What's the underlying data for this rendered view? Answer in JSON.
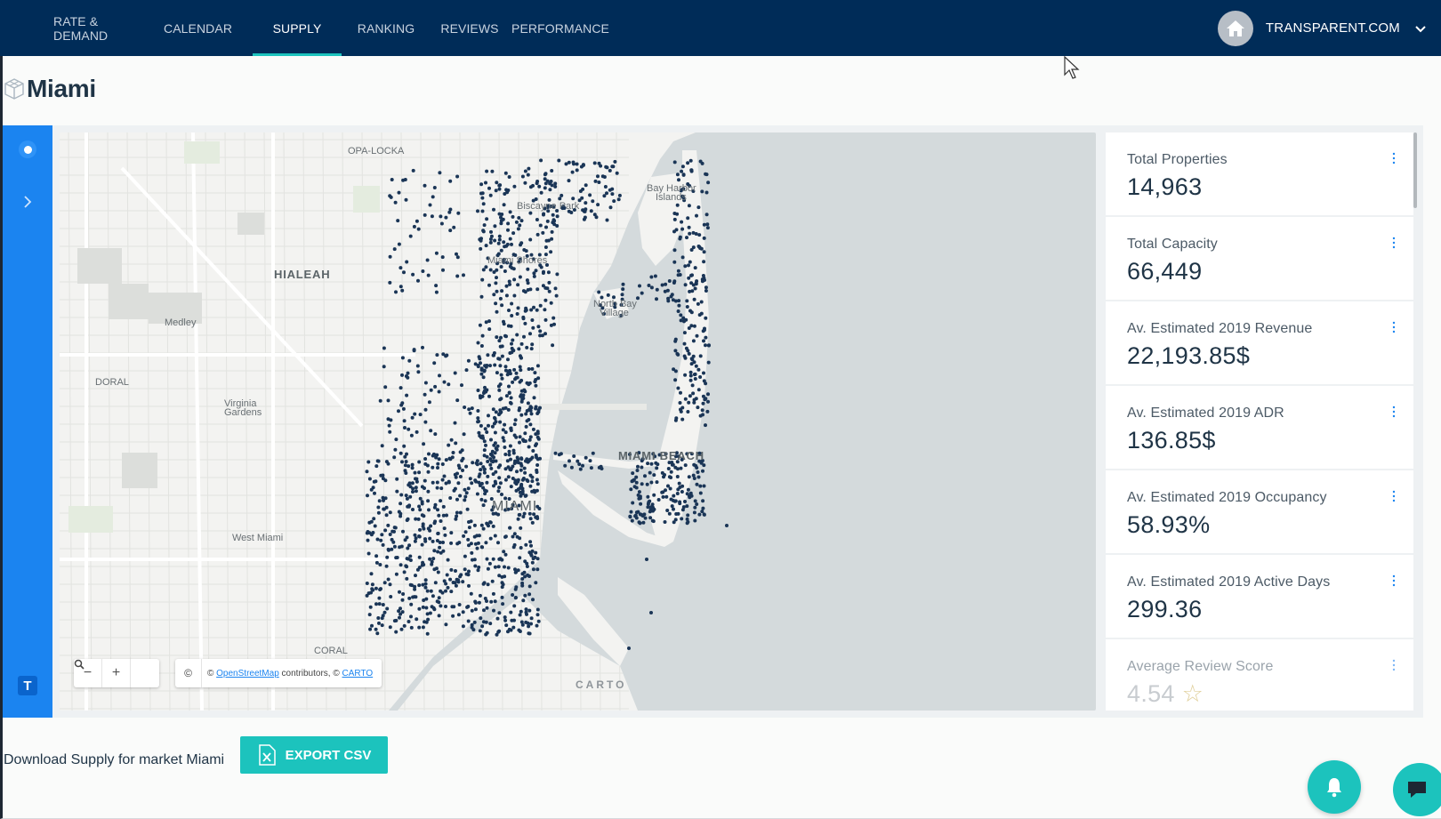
{
  "nav": {
    "tabs": [
      {
        "label": "RATE & DEMAND",
        "active": false
      },
      {
        "label": "CALENDAR",
        "active": false
      },
      {
        "label": "SUPPLY",
        "active": true
      },
      {
        "label": "RANKING",
        "active": false
      },
      {
        "label": "REVIEWS",
        "active": false
      },
      {
        "label": "PERFORMANCE",
        "active": false
      }
    ],
    "account": {
      "name": "TRANSPARENT.COM",
      "avatar_icon": "home-icon",
      "menu_icon": "chevron-down-icon"
    }
  },
  "page": {
    "title": "Miami",
    "title_icon": "cube-icon"
  },
  "map": {
    "labels": {
      "opa_locka": "OPA-LOCKA",
      "hialeah": "HIALEAH",
      "medley": "Medley",
      "doral": "DORAL",
      "virginia_gardens_1": "Virginia",
      "virginia_gardens_2": "Gardens",
      "west_miami": "West Miami",
      "biscayne_park": "Biscayne Park",
      "miami_shores": "Miami Shores",
      "north_bay_1": "North Bay",
      "north_bay_2": "Village",
      "bay_harbor_1": "Bay Harbor",
      "bay_harbor_2": "Islands",
      "miami_beach": "MIAMI BEACH",
      "miami": "MIAMI",
      "coral": "CORAL"
    },
    "controls": {
      "zoom_out": "−",
      "zoom_in": "+",
      "search_icon": "search-icon",
      "info": "©"
    },
    "attribution": {
      "prefix": "©",
      "osm": "OpenStreetMap",
      "middle": "contributors, ©",
      "carto": "CARTO"
    },
    "watermark": "CARTO",
    "point_color": "#1a3556",
    "water_color": "#d4dadc"
  },
  "stats": [
    {
      "label": "Total Properties",
      "value": "14,963"
    },
    {
      "label": "Total Capacity",
      "value": "66,449"
    },
    {
      "label": "Av. Estimated 2019 Revenue",
      "value": "22,193.85$"
    },
    {
      "label": "Av. Estimated 2019 ADR",
      "value": "136.85$"
    },
    {
      "label": "Av. Estimated 2019 Occupancy",
      "value": "58.93%"
    },
    {
      "label": "Av. Estimated 2019 Active Days",
      "value": "299.36"
    },
    {
      "label": "Average Review Score",
      "value": "4.54"
    }
  ],
  "footer": {
    "download_text": "Download Supply for market Miami",
    "export_label": "EXPORT CSV"
  },
  "colors": {
    "nav_bg": "#002c58",
    "accent": "#1cc3bd",
    "sidebar": "#1b84f0"
  }
}
